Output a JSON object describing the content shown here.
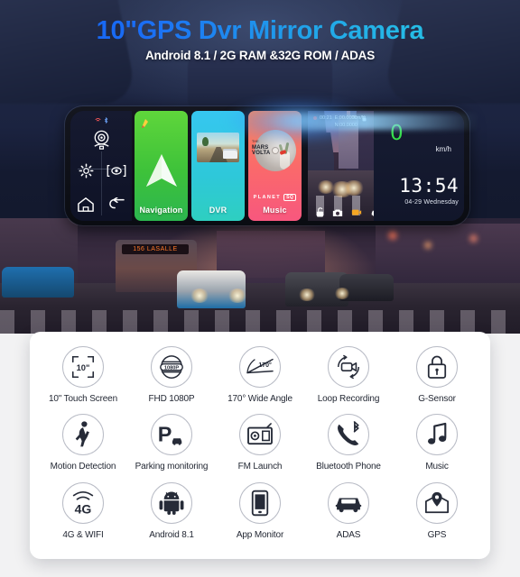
{
  "header": {
    "title": "10\"GPS Dvr Mirror Camera",
    "subtitle": "Android 8.1 / 2G RAM &32G ROM / ADAS",
    "title_gradient_from": "#0f5cf0",
    "title_gradient_to": "#2ad2e4"
  },
  "mirror": {
    "controls": [
      {
        "name": "camera-icon",
        "label": "camera"
      },
      {
        "name": "settings-gear-icon",
        "label": "settings"
      },
      {
        "name": "eye-bracket-icon",
        "label": "monitor"
      },
      {
        "name": "home-icon",
        "label": "home"
      },
      {
        "name": "back-arrow-icon",
        "label": "back"
      }
    ],
    "cards": [
      {
        "label": "Navigation",
        "color": "#3ec23a"
      },
      {
        "label": "DVR",
        "color": "#2ec8d9"
      },
      {
        "label": "Music",
        "color": "#f8577e"
      }
    ],
    "music_card": {
      "artist_line1": "THE",
      "artist_line2": "MARS",
      "artist_line3": "VOLTA",
      "album": "PLANET",
      "album_tag": "SQ"
    },
    "dvr_overlay": {
      "rec_time": "00:21",
      "speed_hud": "0km/h",
      "longitude": "E:00.0000",
      "latitude": "N:00.0000",
      "toolbar": [
        {
          "name": "unlock-icon"
        },
        {
          "name": "photo-camera-icon"
        },
        {
          "name": "video-record-icon"
        },
        {
          "name": "car-icon"
        },
        {
          "name": "microphone-icon"
        },
        {
          "name": "play-icon"
        }
      ]
    },
    "info_panel": {
      "speed_value": "0",
      "speed_unit": "km/h",
      "speed_color": "#36e04a",
      "time": "13:54",
      "date": "04-29 Wednesday"
    }
  },
  "street_scene": {
    "bus_sign": "156  LASALLE"
  },
  "features": [
    {
      "label": "10\" Touch Screen",
      "icon": "screen-size-icon",
      "badge": "10\""
    },
    {
      "label": "FHD 1080P",
      "icon": "resolution-1080p-icon",
      "badge": "1080P"
    },
    {
      "label": "170° Wide Angle",
      "icon": "wide-angle-icon",
      "badge": "170°"
    },
    {
      "label": "Loop Recording",
      "icon": "loop-recording-icon",
      "badge": ""
    },
    {
      "label": "G-Sensor",
      "icon": "lock-g-sensor-icon",
      "badge": ""
    },
    {
      "label": "Motion Detection",
      "icon": "motion-detection-icon",
      "badge": ""
    },
    {
      "label": "Parking monitoring",
      "icon": "parking-monitoring-icon",
      "badge": "P"
    },
    {
      "label": "FM Launch",
      "icon": "fm-radio-icon",
      "badge": ""
    },
    {
      "label": "Bluetooth Phone",
      "icon": "bluetooth-phone-icon",
      "badge": ""
    },
    {
      "label": "Music",
      "icon": "music-note-icon",
      "badge": ""
    },
    {
      "label": "4G & WIFI",
      "icon": "4g-wifi-icon",
      "badge": "4G"
    },
    {
      "label": "Android 8.1",
      "icon": "android-icon",
      "badge": ""
    },
    {
      "label": "App Monitor",
      "icon": "app-monitor-icon",
      "badge": ""
    },
    {
      "label": "ADAS",
      "icon": "adas-car-icon",
      "badge": ""
    },
    {
      "label": "GPS",
      "icon": "gps-location-icon",
      "badge": ""
    }
  ]
}
